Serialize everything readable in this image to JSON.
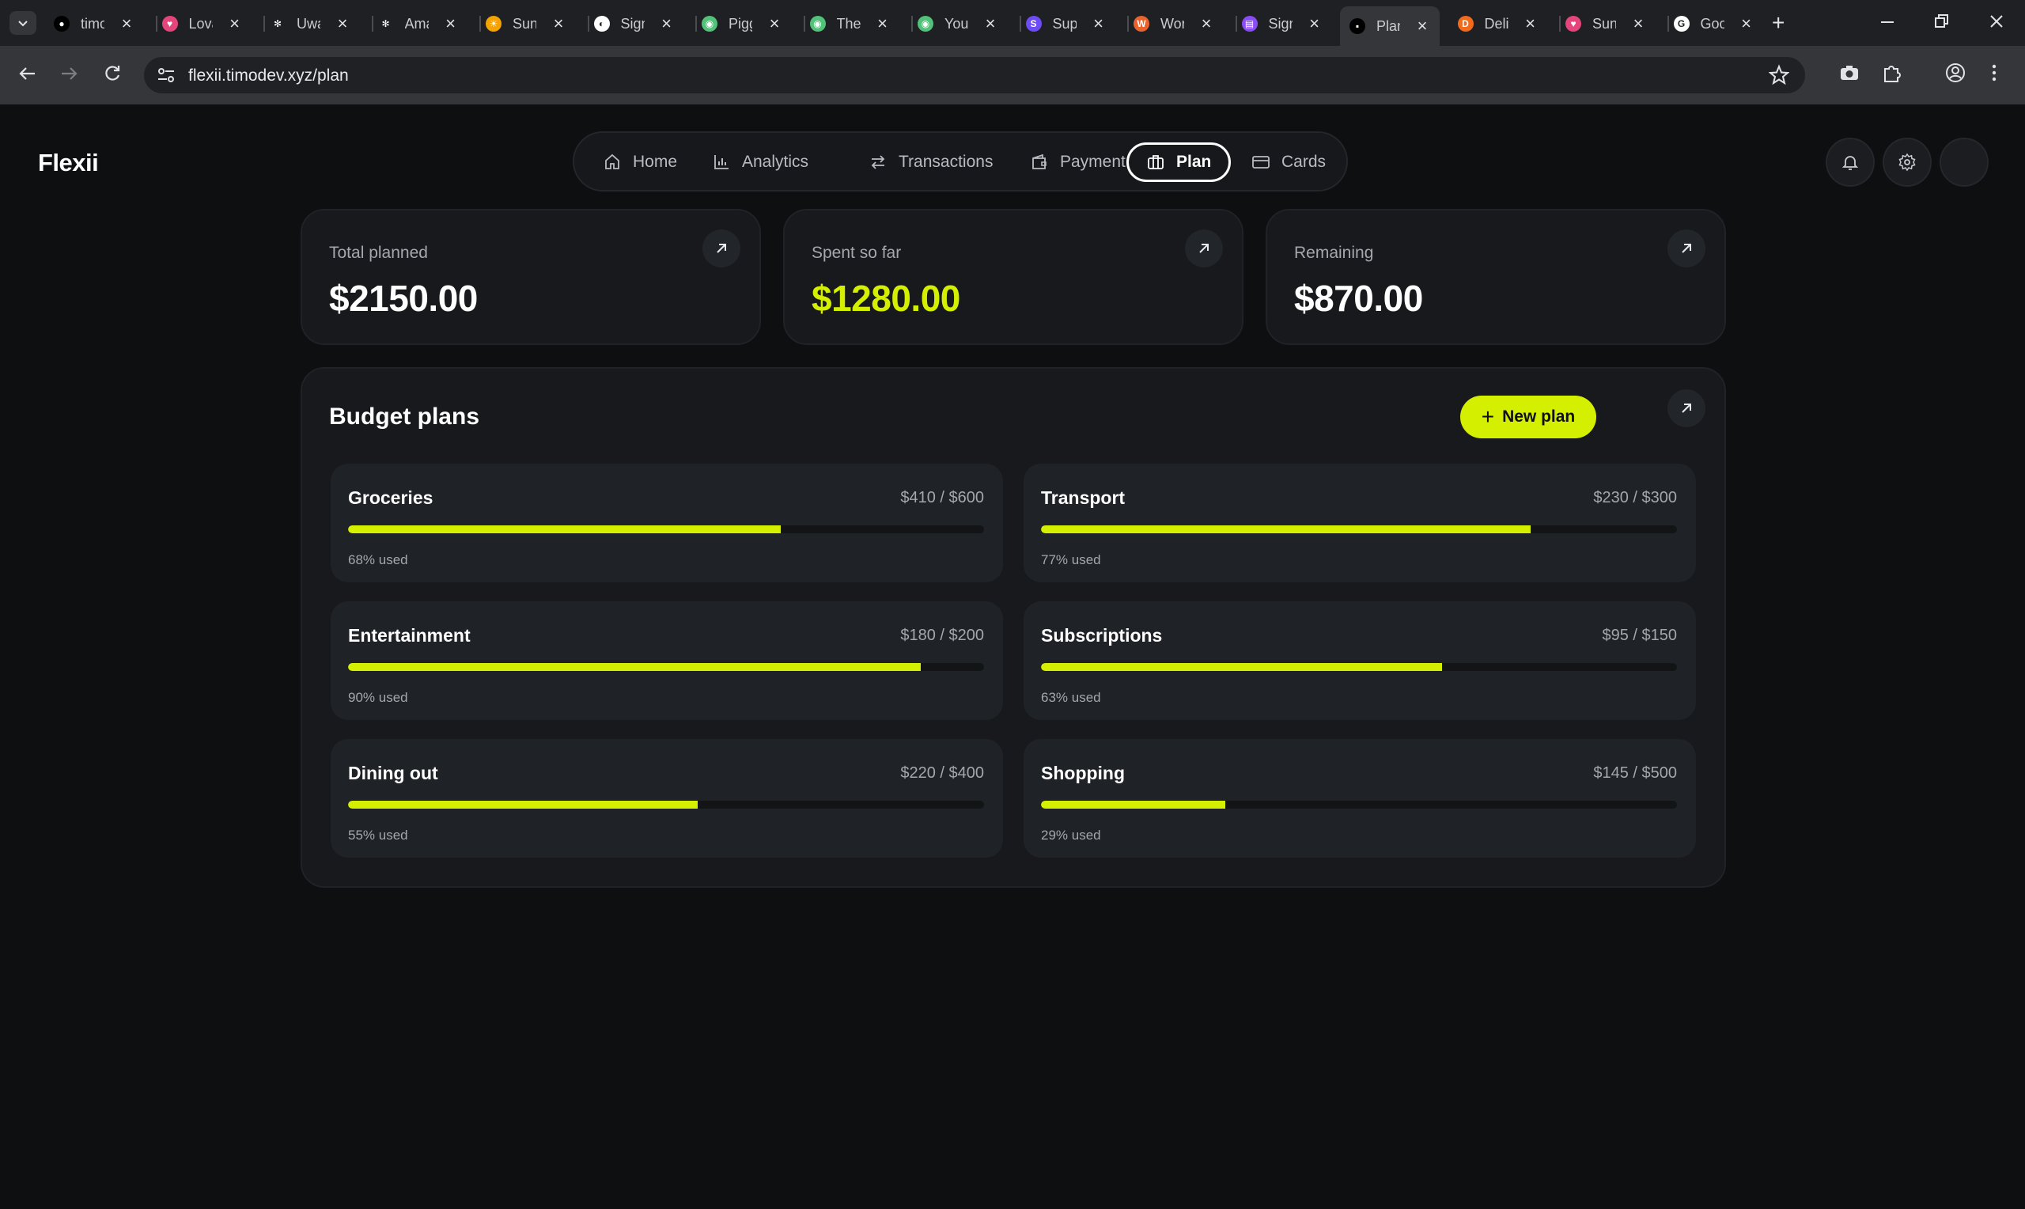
{
  "browser": {
    "tabs": [
      {
        "title": "timodev",
        "favicon_color": "#000000",
        "favicon_glyph": "●"
      },
      {
        "title": "Lovable",
        "favicon_color": "#e4457a",
        "favicon_glyph": "♥"
      },
      {
        "title": "Uwaves",
        "favicon_color": "#1f2023",
        "favicon_glyph": "✻"
      },
      {
        "title": "Amazing",
        "favicon_color": "#1f2023",
        "favicon_glyph": "✻"
      },
      {
        "title": "Sunset",
        "favicon_color": "#f5a300",
        "favicon_glyph": "☀"
      },
      {
        "title": "Sign in",
        "favicon_color": "#ffffff",
        "favicon_glyph": "◐"
      },
      {
        "title": "Piggy",
        "favicon_color": "#52c27a",
        "favicon_glyph": "◉"
      },
      {
        "title": "The",
        "favicon_color": "#52c27a",
        "favicon_glyph": "◉"
      },
      {
        "title": "Your",
        "favicon_color": "#52c27a",
        "favicon_glyph": "◉"
      },
      {
        "title": "Supabase",
        "favicon_color": "#6e4cf5",
        "favicon_glyph": "S"
      },
      {
        "title": "Work",
        "favicon_color": "#e8632d",
        "favicon_glyph": "W"
      },
      {
        "title": "Sign up",
        "favicon_color": "#8a4cf5",
        "favicon_glyph": "▤"
      },
      {
        "title": "Plan",
        "favicon_color": "#000000",
        "favicon_glyph": "▪"
      },
      {
        "title": "Deliver",
        "favicon_color": "#f26a1b",
        "favicon_glyph": "D"
      },
      {
        "title": "Sunset",
        "favicon_color": "#e4457a",
        "favicon_glyph": "♥"
      },
      {
        "title": "Google",
        "favicon_color": "#ffffff",
        "favicon_glyph": "G"
      }
    ],
    "active_tab_index": 12,
    "url": "flexii.timodev.xyz/plan"
  },
  "app": {
    "brand": "Flexii",
    "nav": [
      {
        "label": "Home",
        "icon": "home-icon"
      },
      {
        "label": "Analytics",
        "icon": "bar-chart-icon"
      },
      {
        "label": "Transactions",
        "icon": "swap-arrows-icon"
      },
      {
        "label": "Payment",
        "icon": "wallet-icon"
      },
      {
        "label": "Plan",
        "icon": "briefcase-icon"
      },
      {
        "label": "Cards",
        "icon": "credit-card-icon"
      }
    ],
    "active_nav": "Plan",
    "accent_color": "#d4f000"
  },
  "stats": {
    "total_planned": {
      "label": "Total planned",
      "value": "$2150.00"
    },
    "spent_so_far": {
      "label": "Spent so far",
      "value": "$1280.00"
    },
    "remaining": {
      "label": "Remaining",
      "value": "$870.00"
    }
  },
  "budget": {
    "title": "Budget plans",
    "new_plan_label": "New plan",
    "plans": [
      {
        "name": "Groceries",
        "amount": "$410 / $600",
        "used_label": "68% used",
        "progress": 0.68
      },
      {
        "name": "Transport",
        "amount": "$230 / $300",
        "used_label": "77% used",
        "progress": 0.77
      },
      {
        "name": "Entertainment",
        "amount": "$180 / $200",
        "used_label": "90% used",
        "progress": 0.9
      },
      {
        "name": "Subscriptions",
        "amount": "$95 / $150",
        "used_label": "63% used",
        "progress": 0.63
      },
      {
        "name": "Dining out",
        "amount": "$220 / $400",
        "used_label": "55% used",
        "progress": 0.55
      },
      {
        "name": "Shopping",
        "amount": "$145 / $500",
        "used_label": "29% used",
        "progress": 0.29
      }
    ]
  }
}
